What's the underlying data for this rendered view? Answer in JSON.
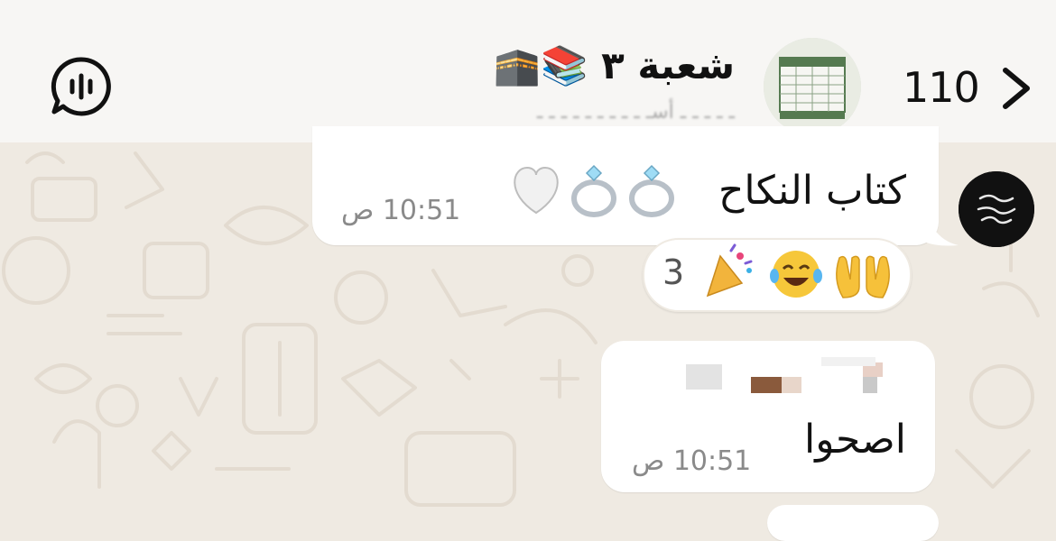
{
  "header": {
    "unread_count": "110",
    "group_title": "شعبة ٣ 📚🕋",
    "group_subtitle": "ـ ـ ـ ـ ـ أسـ ـ ـ ـ ـ ـ ـ ـ ـ ـ",
    "icons": [
      "chevron-left-icon",
      "voice-chat-icon"
    ]
  },
  "messages": [
    {
      "text": "كتاب النكاح",
      "emoji_label": "💍💍🤍",
      "time": "10:51 ص",
      "reactions": {
        "count": "3",
        "emojis": "🤲😂🎉"
      }
    },
    {
      "sender": "",
      "text": "اصحوا",
      "time": "10:51 ص"
    }
  ],
  "colors": {
    "chat_background": "#efeae2",
    "bubble": "#ffffff",
    "header": "#f7f6f4",
    "timestamp": "#8a8a8a"
  }
}
